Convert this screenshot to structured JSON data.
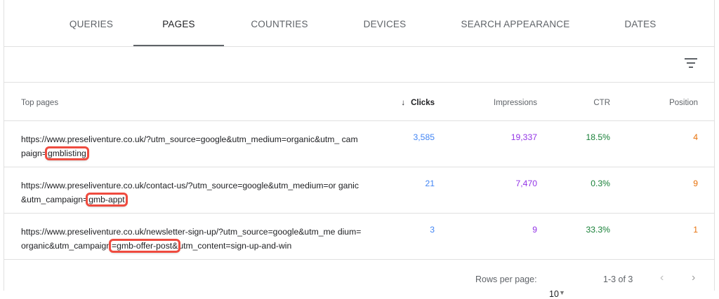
{
  "tabs": [
    "QUERIES",
    "PAGES",
    "COUNTRIES",
    "DEVICES",
    "SEARCH APPEARANCE",
    "DATES"
  ],
  "active_tab": "PAGES",
  "table": {
    "headers": {
      "page": "Top pages",
      "clicks": "Clicks",
      "impressions": "Impressions",
      "ctr": "CTR",
      "position": "Position"
    },
    "sort": "clicks-descending",
    "rows": [
      {
        "url_pre": "https://www.preseliventure.co.uk/?utm_source=google&utm_medium=organic&utm_ campaign=",
        "url_hl": "gmblisting",
        "url_post": "",
        "clicks": "3,585",
        "impressions": "19,337",
        "ctr": "18.5%",
        "position": "4"
      },
      {
        "url_pre": "https://www.preseliventure.co.uk/contact-us/?utm_source=google&utm_medium=or ganic&utm_campaign=",
        "url_hl": "gmb-appt",
        "url_post": "",
        "clicks": "21",
        "impressions": "7,470",
        "ctr": "0.3%",
        "position": "9"
      },
      {
        "url_pre": "https://www.preseliventure.co.uk/newsletter-sign-up/?utm_source=google&utm_me dium=organic&utm_campaign",
        "url_hl": "=gmb-offer-post&",
        "url_post": "utm_content=sign-up-and-win",
        "clicks": "3",
        "impressions": "9",
        "ctr": "33.3%",
        "position": "1"
      }
    ]
  },
  "footer": {
    "rows_per_page_label": "Rows per page:",
    "rows_per_page": "10",
    "range": "1-3 of 3"
  },
  "colors": {
    "clicks": "#4285f4",
    "impressions": "#9334e6",
    "ctr": "#188038",
    "position": "#e8710a",
    "highlight": "#ef4b3f"
  }
}
